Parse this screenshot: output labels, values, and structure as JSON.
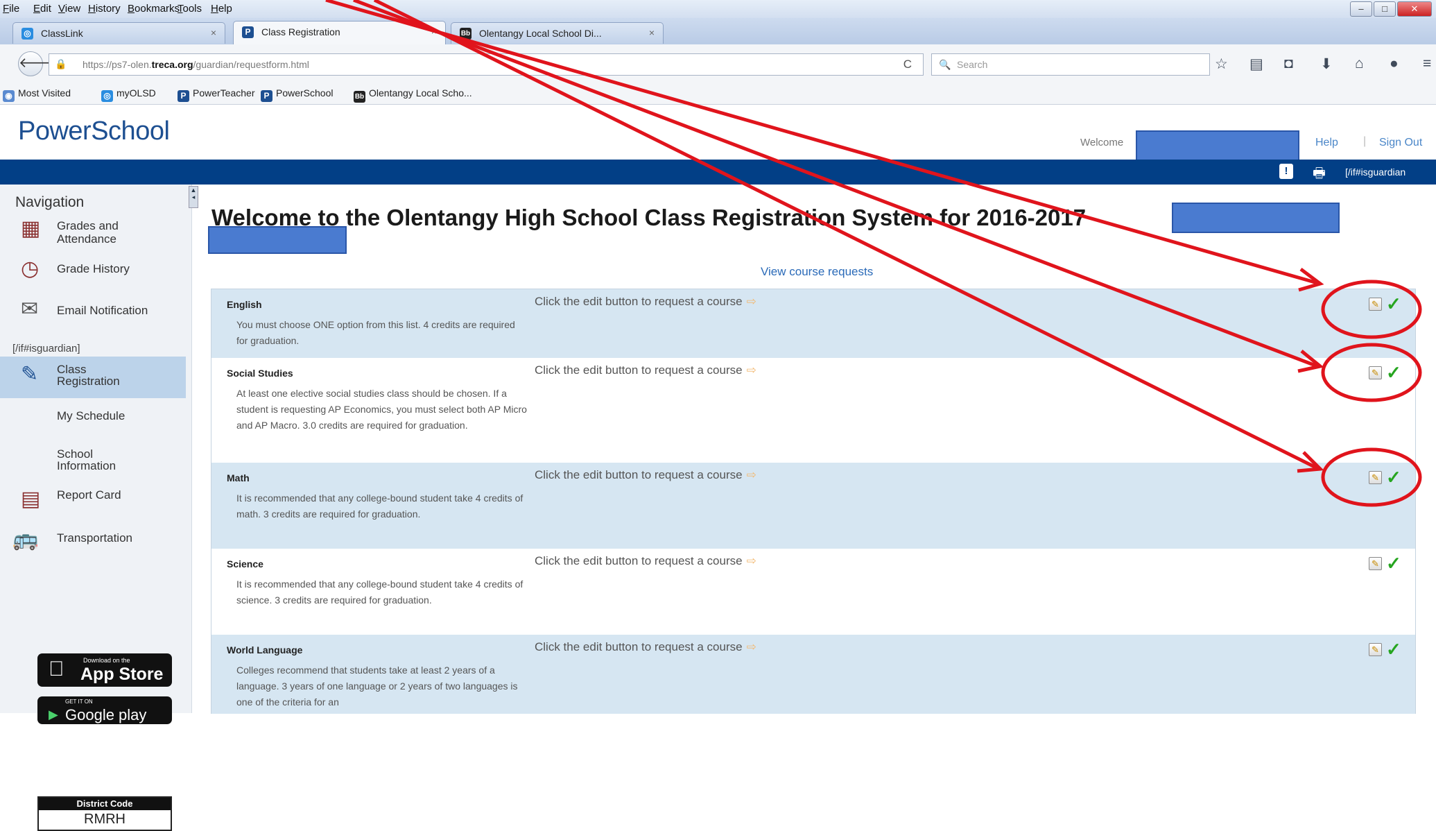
{
  "browser": {
    "menu": [
      "File",
      "Edit",
      "View",
      "History",
      "Bookmarks",
      "Tools",
      "Help"
    ],
    "window_controls": [
      "minimize-icon",
      "maximize-icon",
      "close-icon"
    ],
    "tabs": [
      {
        "label": "ClassLink",
        "icon": "classlink-icon",
        "close": "×",
        "active": false
      },
      {
        "label": "Class Registration",
        "icon": "powerschool-icon",
        "close": "×",
        "active": true
      },
      {
        "label": "Olentangy Local School Di...",
        "icon": "blackboard-icon",
        "close": "×",
        "active": false
      }
    ],
    "new_tab": "+",
    "url_prefix": "https://ps7-olen.",
    "url_host": "treca.org",
    "url_path": "/guardian/requestform.html",
    "reload": "C",
    "search_placeholder": "Search",
    "toolbar_icons": [
      "star-icon",
      "reading-list-icon",
      "pocket-icon",
      "download-icon",
      "home-icon",
      "chat-icon",
      "menu-icon"
    ],
    "bookmarks": [
      {
        "label": "Most Visited",
        "icon": "most-visited-icon"
      },
      {
        "label": "myOLSD",
        "icon": "classlink-icon"
      },
      {
        "label": "PowerTeacher",
        "icon": "powerschool-icon"
      },
      {
        "label": "PowerSchool",
        "icon": "powerschool-icon"
      },
      {
        "label": "Olentangy Local Scho...",
        "icon": "blackboard-icon"
      }
    ]
  },
  "header": {
    "logo": "PowerSchool",
    "welcome": "Welcome",
    "help": "Help",
    "separator": "|",
    "sign_out": "Sign Out",
    "guardian_tag": "[/if#isguardian"
  },
  "sidebar": {
    "heading": "Navigation",
    "guardian_tag": "[/if#isguardian]",
    "items": [
      {
        "label1": "Grades and",
        "label2": "Attendance",
        "icon": "grades-icon"
      },
      {
        "label1": "Grade History",
        "label2": "",
        "icon": "grade-history-icon"
      },
      {
        "label1": "Email Notification",
        "label2": "",
        "icon": "email-icon"
      },
      {
        "label1": "Class",
        "label2": "Registration",
        "icon": "class-registration-icon",
        "selected": true
      },
      {
        "label1": "My Schedule",
        "label2": "",
        "icon": ""
      },
      {
        "label1": "School",
        "label2": "Information",
        "icon": ""
      },
      {
        "label1": "Report Card",
        "label2": "",
        "icon": "report-card-icon"
      },
      {
        "label1": "Transportation",
        "label2": "",
        "icon": "bus-icon"
      }
    ],
    "district_code_label": "District Code",
    "district_code": "RMRH",
    "appstore_small": "Download on the",
    "appstore": "App Store",
    "googleplay_small": "GET IT ON",
    "googleplay": "Google play"
  },
  "main": {
    "title": "Welcome to the Olentangy High School Class Registration System for 2016-2017",
    "view_requests": "View course requests",
    "rows": [
      {
        "subject": "English",
        "desc": "You must choose ONE option from this list. 4 credits are required for graduation.",
        "hint": "Click the edit button to request a course",
        "style": "blue"
      },
      {
        "subject": "Social Studies",
        "desc": "At least one elective social studies class should be chosen. If a student is requesting AP Economics, you must select both AP Micro and AP Macro. 3.0 credits are required for graduation.",
        "hint": "Click the edit button to request a course",
        "style": "white"
      },
      {
        "subject": "Math",
        "desc": "It is recommended that any college-bound student take 4 credits of math. 3 credits are required for graduation.",
        "hint": "Click the edit button to request a course",
        "style": "blue"
      },
      {
        "subject": "Science",
        "desc": "It is recommended that any college-bound student take 4 credits of science. 3 credits are required for graduation.",
        "hint": "Click the edit button to request a course",
        "style": "white"
      },
      {
        "subject": "World Language",
        "desc": "Colleges recommend that students take at least 2 years of a language. 3 years of one language or 2 years of two languages is one of the criteria for an",
        "hint": "Click the edit button to request a course",
        "style": "blue"
      }
    ]
  },
  "colors": {
    "header_bar": "#023f86",
    "link": "#2a6ab8",
    "annotation": "#e0141c",
    "check": "#26a520"
  }
}
